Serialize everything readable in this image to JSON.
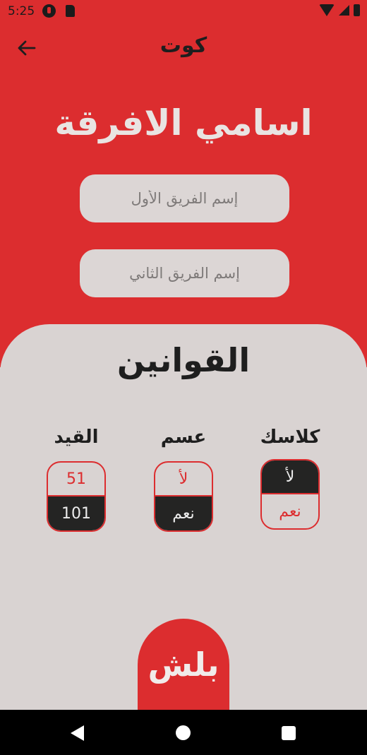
{
  "status_bar": {
    "time": "5:25"
  },
  "header": {
    "title": "كوت"
  },
  "teams": {
    "heading": "اسامي الافرقة",
    "team1_placeholder": "إسم الفريق الأول",
    "team2_placeholder": "إسم الفريق الثاني"
  },
  "rules": {
    "title": "القوانين",
    "columns": [
      {
        "label": "كلاسك",
        "top": "لأ",
        "bottom": "نعم",
        "selected": "top"
      },
      {
        "label": "عسم",
        "top": "لأ",
        "bottom": "نعم",
        "selected": "bottom"
      },
      {
        "label": "القيد",
        "top": "51",
        "bottom": "101",
        "selected": "bottom"
      }
    ]
  },
  "start_button": {
    "label": "بلش"
  },
  "colors": {
    "accent": "#dc2d2f",
    "dark": "#242423",
    "panel": "#d9d3d2"
  }
}
